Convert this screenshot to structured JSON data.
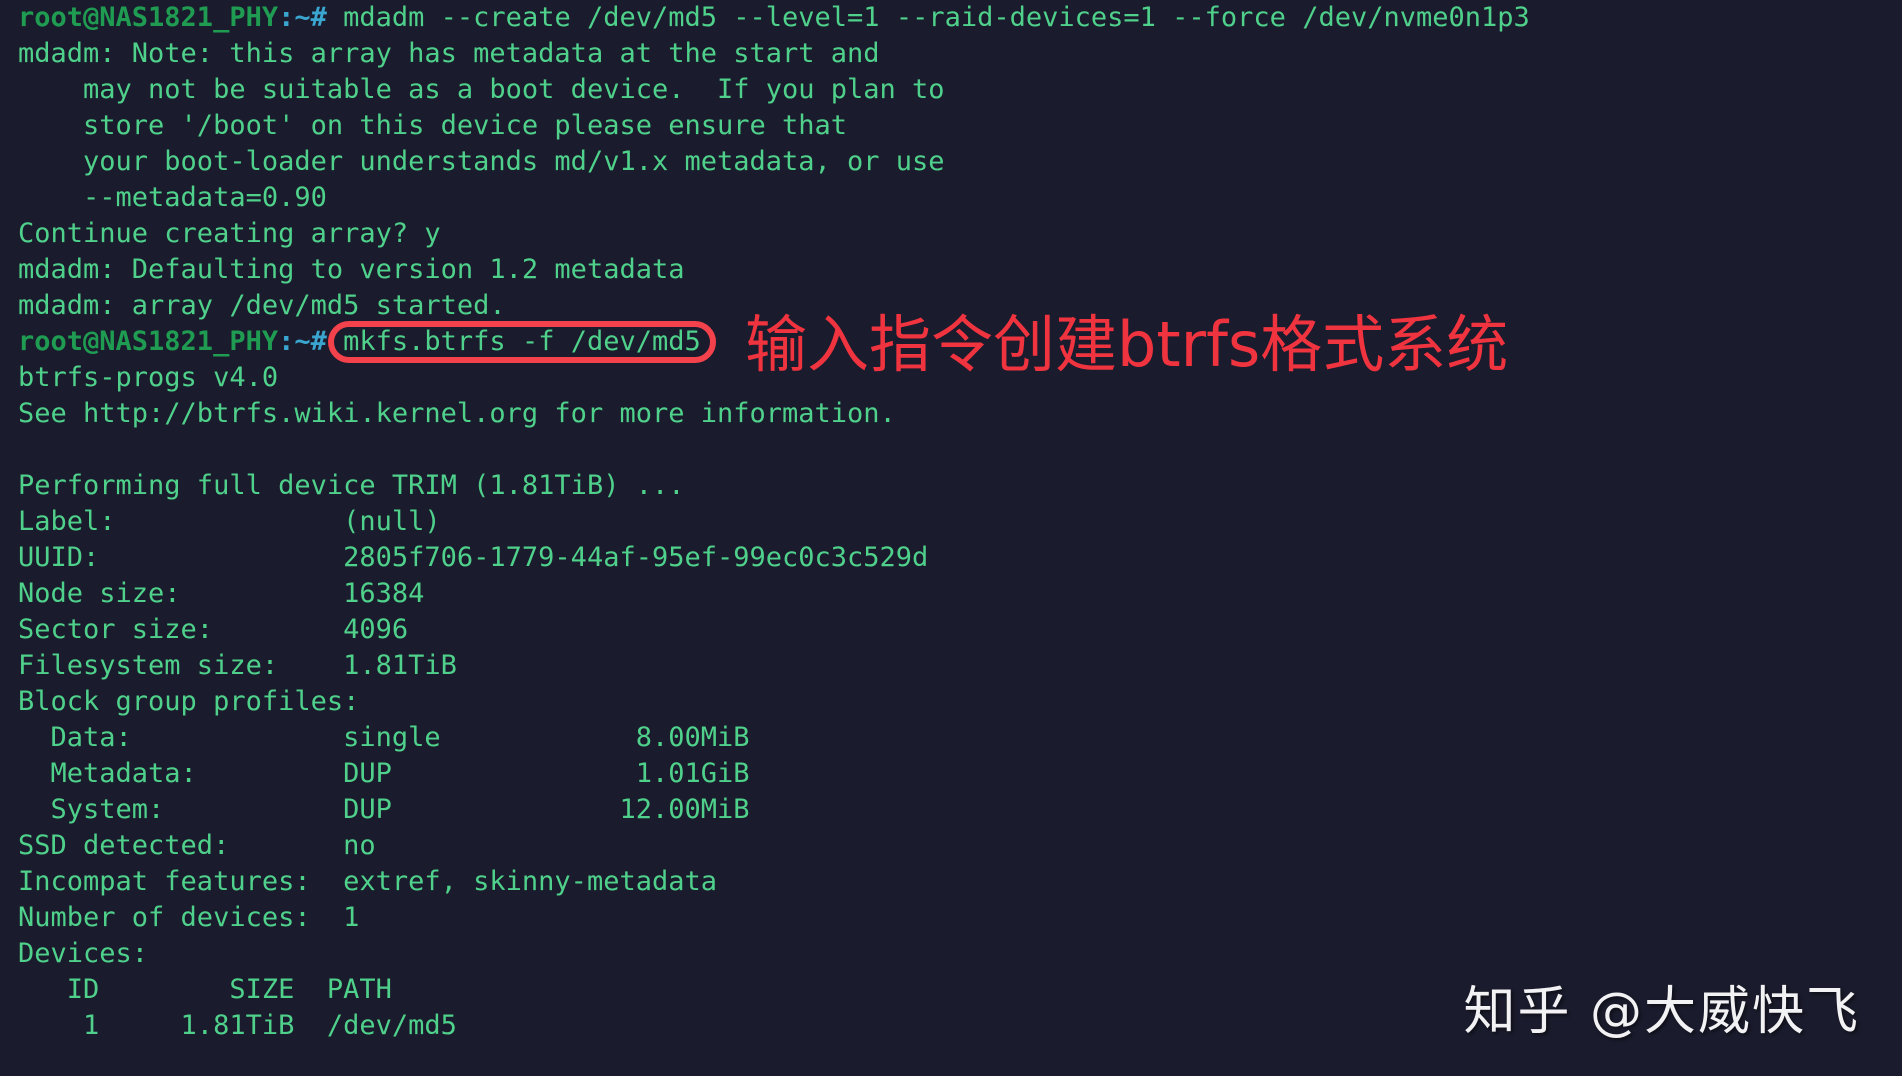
{
  "terminal": {
    "background_color": "#1a1b2c",
    "text_color": "#4fd18b",
    "prompt_color": "#1f9c52",
    "prompt_string": "root@NAS1821_PHY",
    "prompt_path": ":~#",
    "lines": [
      {
        "type": "prompt",
        "user": "root@NAS1821_PHY",
        "path": ":~#",
        "command": " mdadm --create /dev/md5 --level=1 --raid-devices=1 --force /dev/nvme0n1p3"
      },
      {
        "type": "output",
        "text": "mdadm: Note: this array has metadata at the start and"
      },
      {
        "type": "output",
        "text": "    may not be suitable as a boot device.  If you plan to"
      },
      {
        "type": "output",
        "text": "    store '/boot' on this device please ensure that"
      },
      {
        "type": "output",
        "text": "    your boot-loader understands md/v1.x metadata, or use"
      },
      {
        "type": "output",
        "text": "    --metadata=0.90"
      },
      {
        "type": "output",
        "text": "Continue creating array? y"
      },
      {
        "type": "output",
        "text": "mdadm: Defaulting to version 1.2 metadata"
      },
      {
        "type": "output",
        "text": "mdadm: array /dev/md5 started."
      },
      {
        "type": "prompt",
        "user": "root@NAS1821_PHY",
        "path": ":~#",
        "command": " mkfs.btrfs -f /dev/md5"
      },
      {
        "type": "output",
        "text": "btrfs-progs v4.0"
      },
      {
        "type": "output",
        "text": "See http://btrfs.wiki.kernel.org for more information."
      },
      {
        "type": "blank",
        "text": " "
      },
      {
        "type": "output",
        "text": "Performing full device TRIM (1.81TiB) ..."
      },
      {
        "type": "output",
        "text": "Label:              (null)"
      },
      {
        "type": "output",
        "text": "UUID:               2805f706-1779-44af-95ef-99ec0c3c529d"
      },
      {
        "type": "output",
        "text": "Node size:          16384"
      },
      {
        "type": "output",
        "text": "Sector size:        4096"
      },
      {
        "type": "output",
        "text": "Filesystem size:    1.81TiB"
      },
      {
        "type": "output",
        "text": "Block group profiles:"
      },
      {
        "type": "output",
        "text": "  Data:             single            8.00MiB"
      },
      {
        "type": "output",
        "text": "  Metadata:         DUP               1.01GiB"
      },
      {
        "type": "output",
        "text": "  System:           DUP              12.00MiB"
      },
      {
        "type": "output",
        "text": "SSD detected:       no"
      },
      {
        "type": "output",
        "text": "Incompat features:  extref, skinny-metadata"
      },
      {
        "type": "output",
        "text": "Number of devices:  1"
      },
      {
        "type": "output",
        "text": "Devices:"
      },
      {
        "type": "output",
        "text": "   ID        SIZE  PATH"
      },
      {
        "type": "output",
        "text": "    1     1.81TiB  /dev/md5"
      }
    ]
  },
  "annotation": {
    "text": "输入指令创建btrfs格式系统",
    "color": "#f0343f",
    "highlighted_command": "mkfs.btrfs -f /dev/md5",
    "box_color": "#f4424c"
  },
  "watermark": {
    "text": "知乎 @大威快飞",
    "color": "#f2f2f4"
  }
}
